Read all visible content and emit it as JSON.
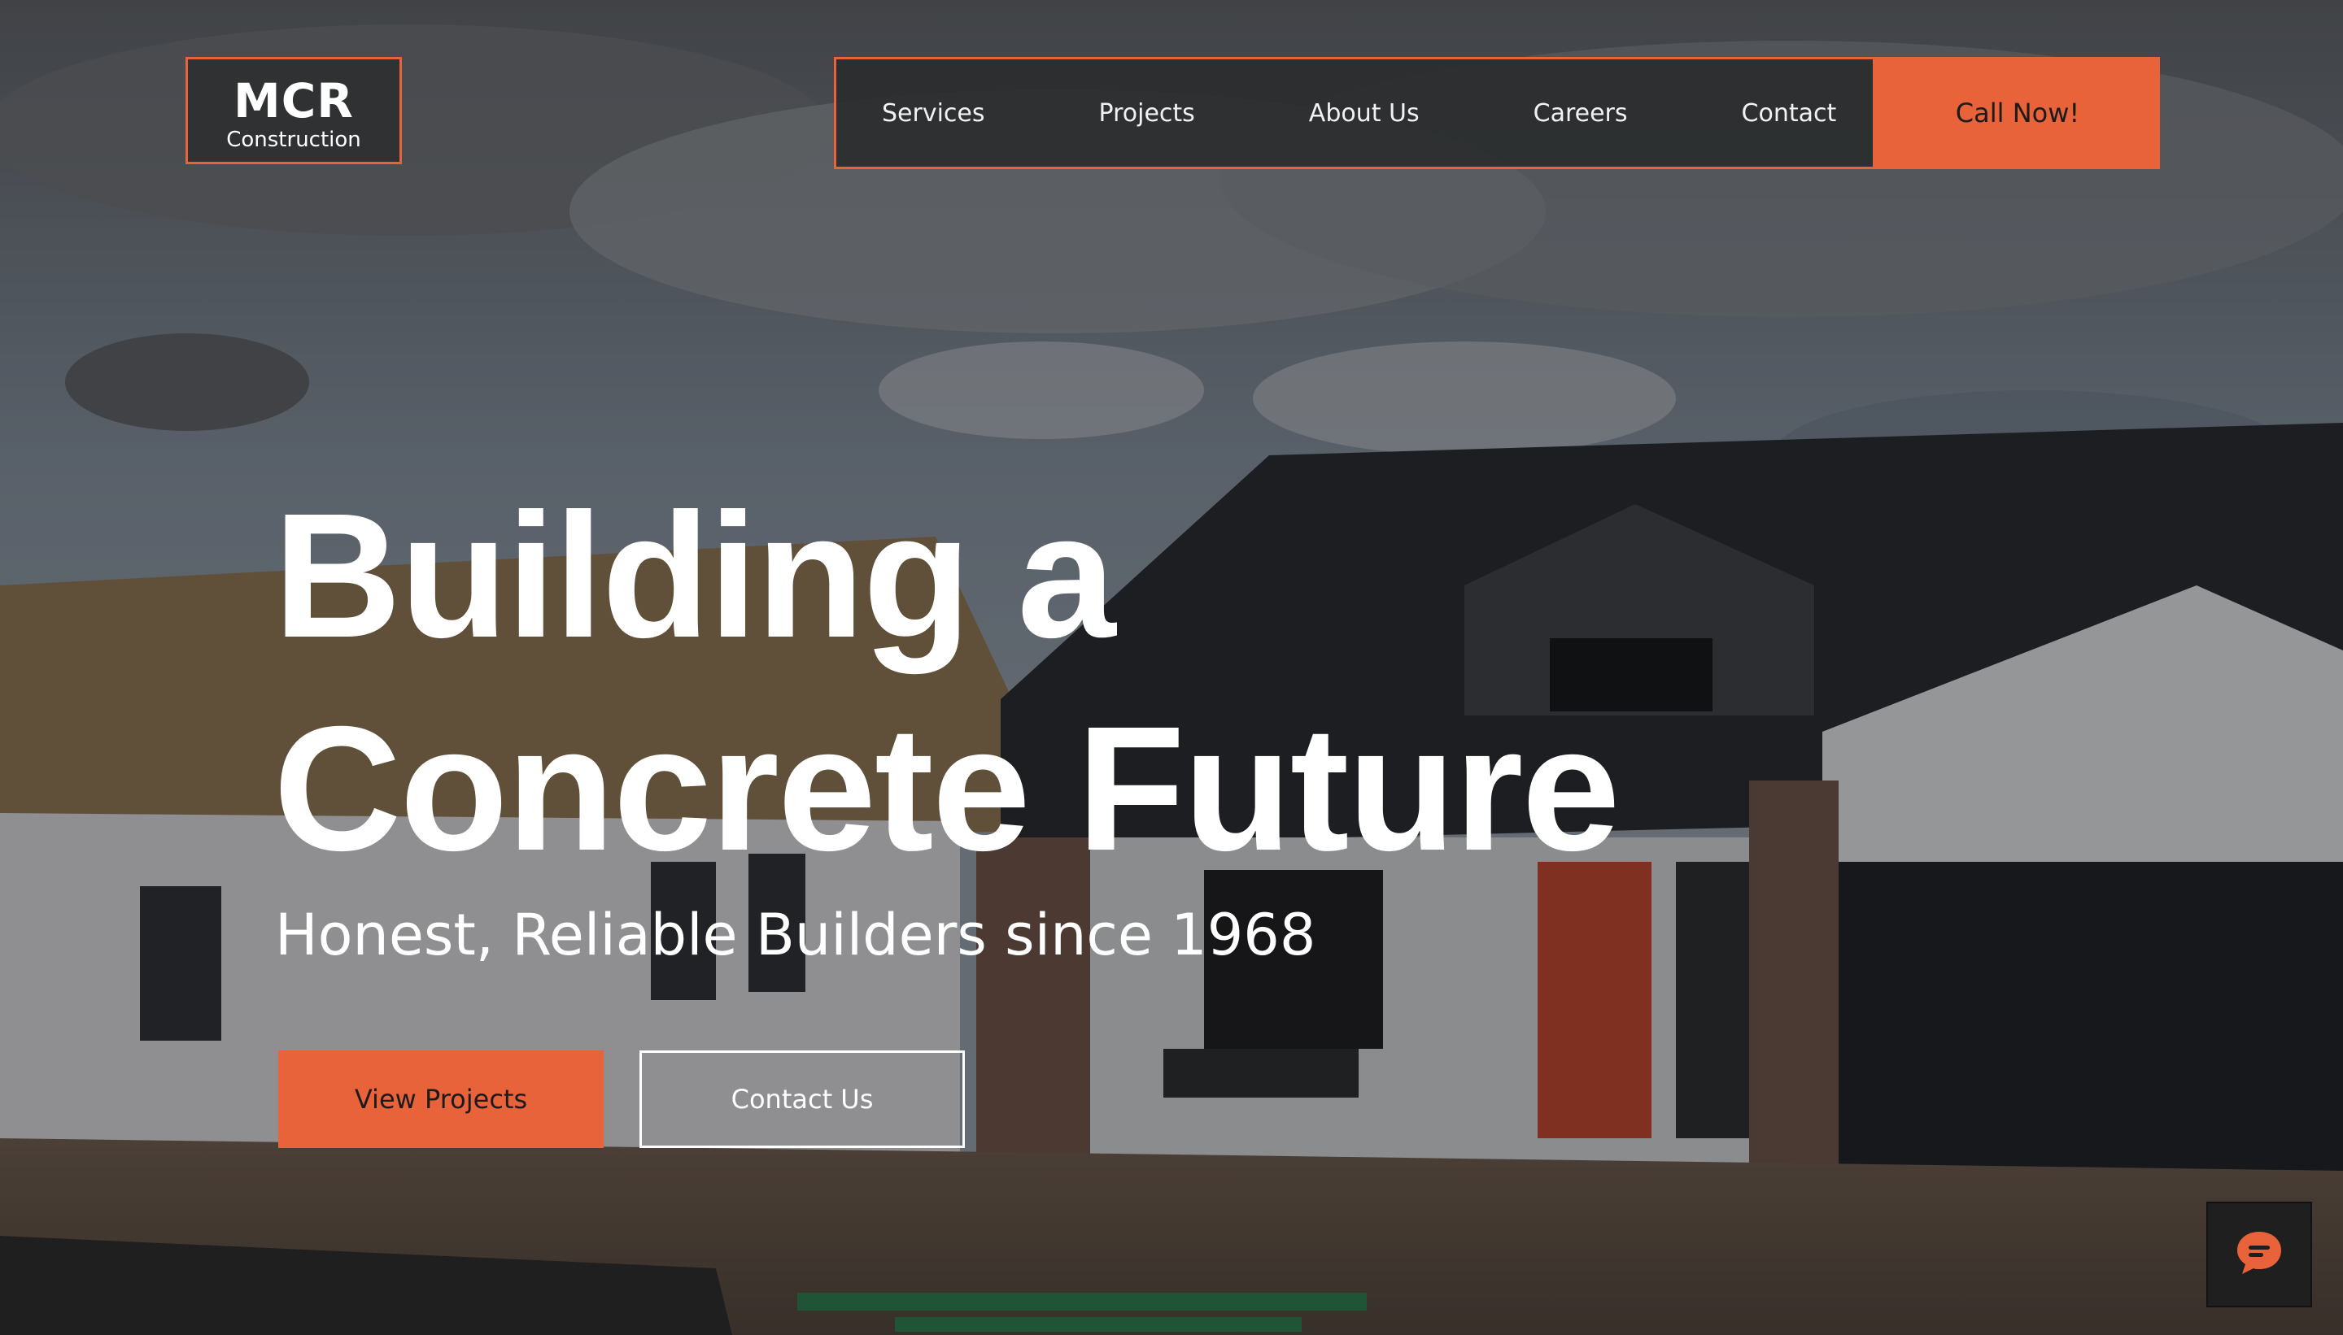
{
  "logo": {
    "name": "MCR",
    "subtitle": "Construction"
  },
  "nav": {
    "items": [
      {
        "label": "Services"
      },
      {
        "label": "Projects"
      },
      {
        "label": "About Us"
      },
      {
        "label": "Careers"
      },
      {
        "label": "Contact"
      }
    ],
    "cta_label": "Call Now!"
  },
  "hero": {
    "headline_line1": "Building a",
    "headline_line2": "Concrete Future",
    "subheadline": "Honest, Reliable Builders since 1968",
    "primary_button": "View Projects",
    "secondary_button": "Contact Us"
  },
  "chat": {
    "icon": "chat-bubble-icon"
  },
  "colors": {
    "accent": "#e8623a",
    "nav_background": "#2f3133",
    "text_light": "#ffffff"
  }
}
